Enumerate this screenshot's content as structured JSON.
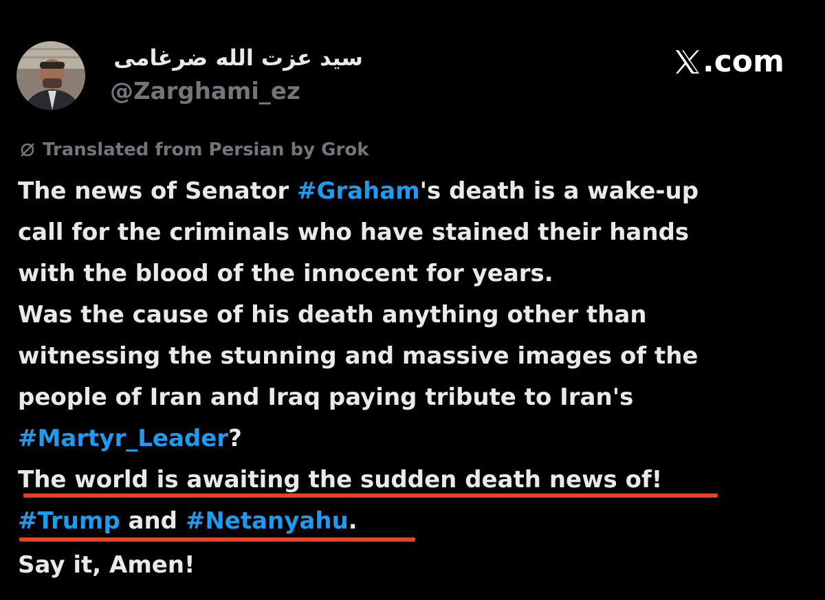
{
  "author": {
    "display_name": "سيد عزت الله ضرغامی",
    "handle": "@Zarghami_ez",
    "avatar_icon": "profile-photo"
  },
  "brand": {
    "icon": "x-logo-icon",
    "label": ".com"
  },
  "translation_note": {
    "icon": "translate-glyph-icon",
    "text": "Translated from Persian by Grok"
  },
  "tweet": {
    "l1_a": "The news of Senator ",
    "l1_tag": "#Graham",
    "l1_b": "'s death is a wake-up",
    "l2": "call for the criminals who have stained their hands",
    "l3": "with the blood of the innocent for years.",
    "l4": "Was the cause of his death anything other than",
    "l5": "witnessing the stunning and massive images of the",
    "l6": "people of Iran and Iraq paying tribute to Iran's",
    "l7_tag": "#Martyr_Leader",
    "l7_b": "?",
    "l8": "The world is awaiting the sudden death news of!",
    "l9_tag1": "#Trump",
    "l9_mid": " and ",
    "l9_tag2": "#Netanyahu",
    "l9_end": ".",
    "l10": "Say it, Amen!"
  },
  "colors": {
    "background": "#000000",
    "text": "#e7e9ea",
    "secondary": "#71767b",
    "hashtag": "#1d9bf0",
    "underline_annotation": "#e8402f"
  }
}
